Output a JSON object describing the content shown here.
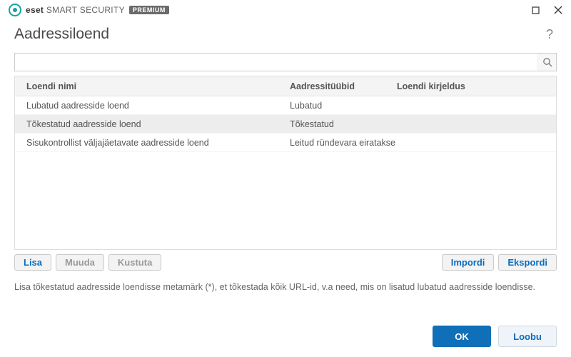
{
  "brand": {
    "name_bold": "eset",
    "name_light1": "SMART",
    "name_light2": "SECURITY",
    "badge": "PREMIUM"
  },
  "header": {
    "title": "Aadressiloend"
  },
  "search": {
    "value": ""
  },
  "table": {
    "columns": {
      "name": "Loendi nimi",
      "type": "Aadressitüübid",
      "desc": "Loendi kirjeldus"
    },
    "rows": [
      {
        "name": "Lubatud aadresside loend",
        "type": "Lubatud",
        "desc": "",
        "selected": false
      },
      {
        "name": "Tõkestatud aadresside loend",
        "type": "Tõkestatud",
        "desc": "",
        "selected": true
      },
      {
        "name": "Sisukontrollist väljajäetavate aadresside loend",
        "type": "Leitud ründevara eiratakse",
        "desc": "",
        "selected": false
      }
    ]
  },
  "toolbar": {
    "add": "Lisa",
    "edit": "Muuda",
    "delete": "Kustuta",
    "import": "Impordi",
    "export": "Ekspordi"
  },
  "hint": "Lisa tõkestatud aadresside loendisse metamärk (*), et tõkestada kõik URL-id, v.a need, mis on lisatud lubatud aadresside loendisse.",
  "footer": {
    "ok": "OK",
    "cancel": "Loobu"
  }
}
